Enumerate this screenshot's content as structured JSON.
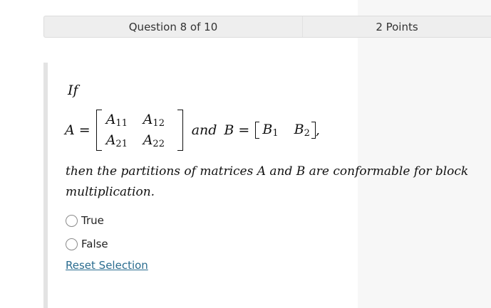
{
  "header": {
    "question_label": "Question 8 of 10",
    "points_label": "2 Points"
  },
  "question": {
    "if_text": "If",
    "A_lhs": "A =",
    "A11_base": "A",
    "A11_sub": "11",
    "A12_base": "A",
    "A12_sub": "12",
    "A21_base": "A",
    "A21_sub": "21",
    "A22_base": "A",
    "A22_sub": "22",
    "and_text": "and",
    "B_lhs": "B =",
    "B1_base": "B",
    "B1_sub": "1",
    "B2_base": "B",
    "B2_sub": "2",
    "comma": ",",
    "statement": "then the partitions of matrices A and B are conformable for block multiplication."
  },
  "options": [
    {
      "label": "True",
      "selected": false
    },
    {
      "label": "False",
      "selected": false
    }
  ],
  "reset_label": "Reset Selection"
}
